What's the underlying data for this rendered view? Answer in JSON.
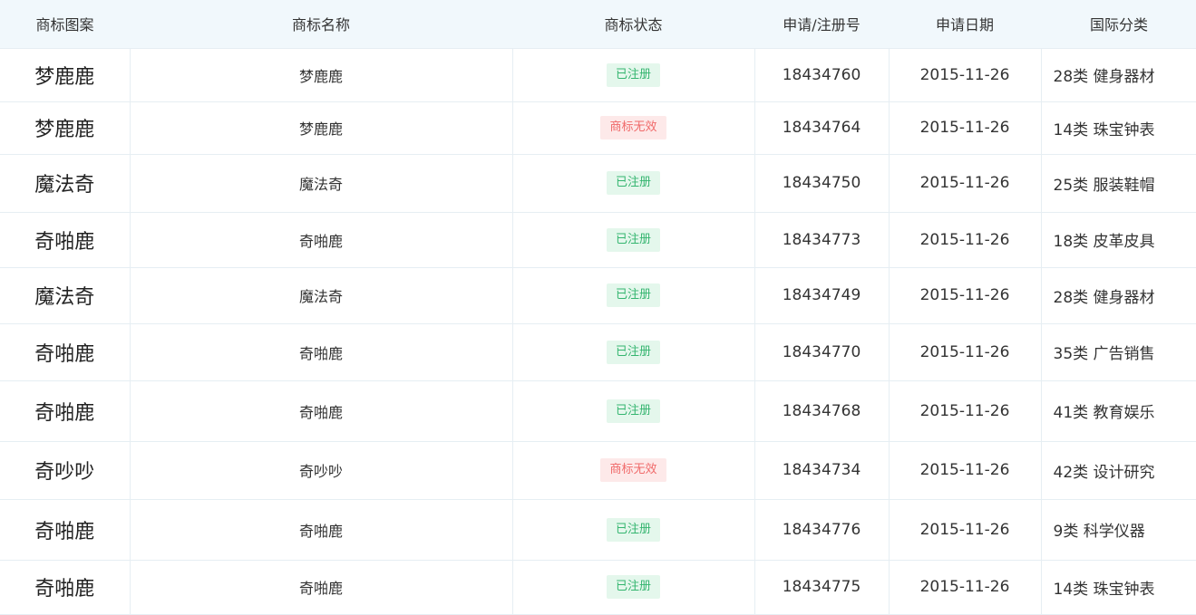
{
  "columns": {
    "image": "商标图案",
    "name": "商标名称",
    "status": "商标状态",
    "app_no": "申请/注册号",
    "date": "申请日期",
    "class": "国际分类"
  },
  "colors": {
    "header_bg": "#f1f8fc",
    "registered_bg": "#e4f7ec",
    "registered_text": "#34b56f",
    "invalid_bg": "#fde9e9",
    "invalid_text": "#f06a6a",
    "border": "#e6eef3"
  },
  "rows": [
    {
      "image_text": "梦鹿鹿",
      "name": "梦鹿鹿",
      "status": "已注册",
      "status_type": "registered",
      "app_no": "18434760",
      "date": "2015-11-26",
      "class": "28类 健身器材"
    },
    {
      "image_text": "梦鹿鹿",
      "name": "梦鹿鹿",
      "status": "商标无效",
      "status_type": "invalid",
      "app_no": "18434764",
      "date": "2015-11-26",
      "class": "14类 珠宝钟表"
    },
    {
      "image_text": "魔法奇",
      "name": "魔法奇",
      "status": "已注册",
      "status_type": "registered",
      "app_no": "18434750",
      "date": "2015-11-26",
      "class": "25类 服装鞋帽"
    },
    {
      "image_text": "奇啪鹿",
      "name": "奇啪鹿",
      "status": "已注册",
      "status_type": "registered",
      "app_no": "18434773",
      "date": "2015-11-26",
      "class": "18类 皮革皮具"
    },
    {
      "image_text": "魔法奇",
      "name": "魔法奇",
      "status": "已注册",
      "status_type": "registered",
      "app_no": "18434749",
      "date": "2015-11-26",
      "class": "28类 健身器材"
    },
    {
      "image_text": "奇啪鹿",
      "name": "奇啪鹿",
      "status": "已注册",
      "status_type": "registered",
      "app_no": "18434770",
      "date": "2015-11-26",
      "class": "35类 广告销售"
    },
    {
      "image_text": "奇啪鹿",
      "name": "奇啪鹿",
      "status": "已注册",
      "status_type": "registered",
      "app_no": "18434768",
      "date": "2015-11-26",
      "class": "41类 教育娱乐"
    },
    {
      "image_text": "奇吵吵",
      "name": "奇吵吵",
      "status": "商标无效",
      "status_type": "invalid",
      "app_no": "18434734",
      "date": "2015-11-26",
      "class": "42类 设计研究"
    },
    {
      "image_text": "奇啪鹿",
      "name": "奇啪鹿",
      "status": "已注册",
      "status_type": "registered",
      "app_no": "18434776",
      "date": "2015-11-26",
      "class": "9类 科学仪器"
    },
    {
      "image_text": "奇啪鹿",
      "name": "奇啪鹿",
      "status": "已注册",
      "status_type": "registered",
      "app_no": "18434775",
      "date": "2015-11-26",
      "class": "14类 珠宝钟表"
    }
  ]
}
